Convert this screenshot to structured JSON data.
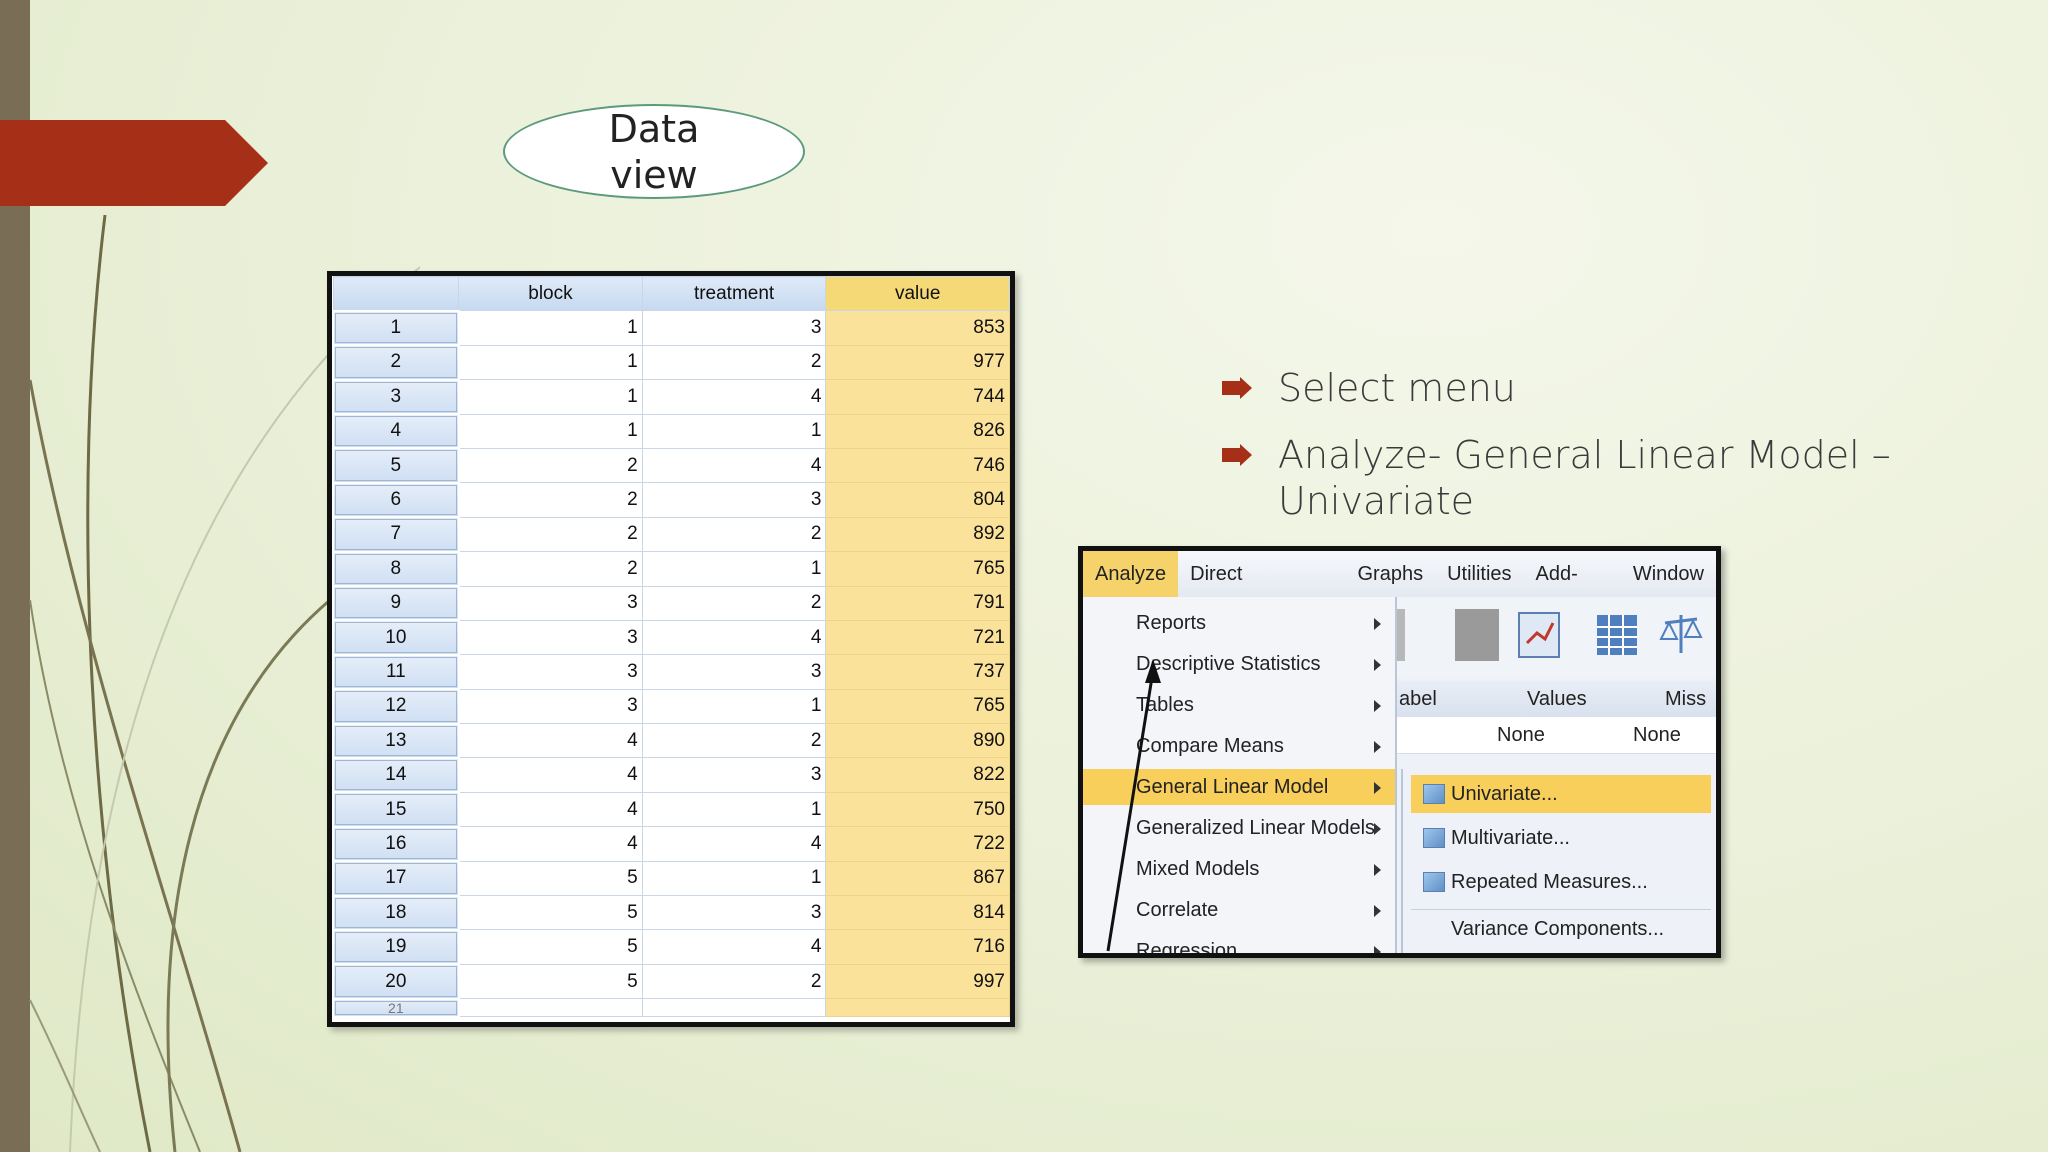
{
  "callout": {
    "line1": "Data",
    "line2": "view"
  },
  "grid": {
    "columns": [
      "",
      "block",
      "treatment",
      "value"
    ],
    "rows": [
      {
        "n": "1",
        "block": "1",
        "treatment": "3",
        "value": "853"
      },
      {
        "n": "2",
        "block": "1",
        "treatment": "2",
        "value": "977"
      },
      {
        "n": "3",
        "block": "1",
        "treatment": "4",
        "value": "744"
      },
      {
        "n": "4",
        "block": "1",
        "treatment": "1",
        "value": "826"
      },
      {
        "n": "5",
        "block": "2",
        "treatment": "4",
        "value": "746"
      },
      {
        "n": "6",
        "block": "2",
        "treatment": "3",
        "value": "804"
      },
      {
        "n": "7",
        "block": "2",
        "treatment": "2",
        "value": "892"
      },
      {
        "n": "8",
        "block": "2",
        "treatment": "1",
        "value": "765"
      },
      {
        "n": "9",
        "block": "3",
        "treatment": "2",
        "value": "791"
      },
      {
        "n": "10",
        "block": "3",
        "treatment": "4",
        "value": "721"
      },
      {
        "n": "11",
        "block": "3",
        "treatment": "3",
        "value": "737"
      },
      {
        "n": "12",
        "block": "3",
        "treatment": "1",
        "value": "765"
      },
      {
        "n": "13",
        "block": "4",
        "treatment": "2",
        "value": "890"
      },
      {
        "n": "14",
        "block": "4",
        "treatment": "3",
        "value": "822"
      },
      {
        "n": "15",
        "block": "4",
        "treatment": "1",
        "value": "750"
      },
      {
        "n": "16",
        "block": "4",
        "treatment": "4",
        "value": "722"
      },
      {
        "n": "17",
        "block": "5",
        "treatment": "1",
        "value": "867"
      },
      {
        "n": "18",
        "block": "5",
        "treatment": "3",
        "value": "814"
      },
      {
        "n": "19",
        "block": "5",
        "treatment": "4",
        "value": "716"
      },
      {
        "n": "20",
        "block": "5",
        "treatment": "2",
        "value": "997"
      }
    ],
    "partial_row": "21"
  },
  "bullets": [
    "Select menu",
    "Analyze- General Linear Model – Univariate"
  ],
  "menu": {
    "menubar": [
      "Analyze",
      "Direct Marketing",
      "Graphs",
      "Utilities",
      "Add-ons",
      "Window"
    ],
    "dropdown": [
      "Reports",
      "Descriptive Statistics",
      "Tables",
      "Compare Means",
      "General Linear Model",
      "Generalized Linear Models",
      "Mixed Models",
      "Correlate",
      "Regression"
    ],
    "highlighted": "General Linear Model",
    "variable_view": {
      "headers": [
        "abel",
        "Values",
        "Miss"
      ],
      "row": [
        "None",
        "None"
      ]
    },
    "submenu": [
      "Univariate...",
      "Multivariate...",
      "Repeated Measures...",
      "Variance Components..."
    ]
  },
  "colors": {
    "accent_red": "#a52f17",
    "highlight": "#f7cf5a",
    "value_column": "#fbe29a"
  }
}
